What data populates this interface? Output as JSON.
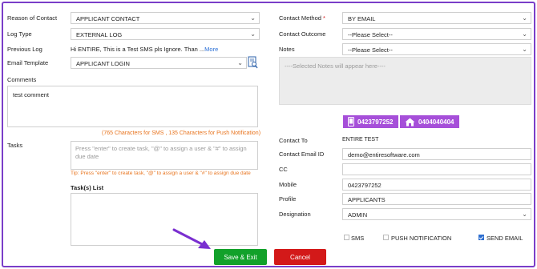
{
  "left": {
    "reason_label": "Reason of Contact",
    "reason_value": "APPLICANT CONTACT",
    "logtype_label": "Log Type",
    "logtype_value": "EXTERNAL LOG",
    "prevlog_label": "Previous Log",
    "prevlog_text": "Hi ENTIRE, This is a Test SMS pls Ignore. Than ...",
    "prevlog_more": "More",
    "template_label": "Email Template",
    "template_value": "APPLICANT LOGIN",
    "comments_label": "Comments",
    "comments_value": "test comment",
    "char_counter": "(765 Characters for SMS , 135 Characters for Push Notification)",
    "tasks_label": "Tasks",
    "tasks_placeholder": "Press \"enter\" to create task, \"@\" to assign a user & \"#\" to assign due date",
    "tip": "Tip: Press \"enter\" to create task, \"@\" to assign a user & \"#\" to assign due date",
    "tasklist_label": "Task(s) List"
  },
  "right": {
    "method_label": "Contact Method",
    "method_value": "BY EMAIL",
    "outcome_label": "Contact Outcome",
    "outcome_value": "--Please Select--",
    "notes_label": "Notes",
    "notes_value": "--Please Select--",
    "notes_area": "----Selected Notes will appear here----",
    "phone1": "0423797252",
    "phone2": "0404040404",
    "contactto_label": "Contact To",
    "contactto_value": "ENTIRE TEST",
    "email_label": "Contact Email ID",
    "email_value": "demo@entiresoftware.com",
    "cc_label": "CC",
    "cc_value": "",
    "mobile_label": "Mobile",
    "mobile_value": "0423797252",
    "profile_label": "Profile",
    "profile_value": "APPLICANTS",
    "designation_label": "Designation",
    "designation_value": "ADMIN",
    "sms_label": "SMS",
    "push_label": "PUSH NOTIFICATION",
    "sendemail_label": "SEND EMAIL",
    "sms_checked": false,
    "push_checked": false,
    "sendemail_checked": true
  },
  "actions": {
    "save_label": "Save & Exit",
    "cancel_label": "Cancel"
  },
  "icons": {
    "chevron": "chevron-down-icon",
    "preview": "document-preview-icon",
    "phone": "mobile-phone-icon",
    "home": "home-icon",
    "arrow": "pointer-arrow-icon"
  },
  "colors": {
    "frame": "#7a3ec8",
    "phone_button": "#a64fd9",
    "save": "#12a12a",
    "cancel": "#d31919",
    "tip": "#e8741e",
    "link": "#2a6fd6"
  }
}
